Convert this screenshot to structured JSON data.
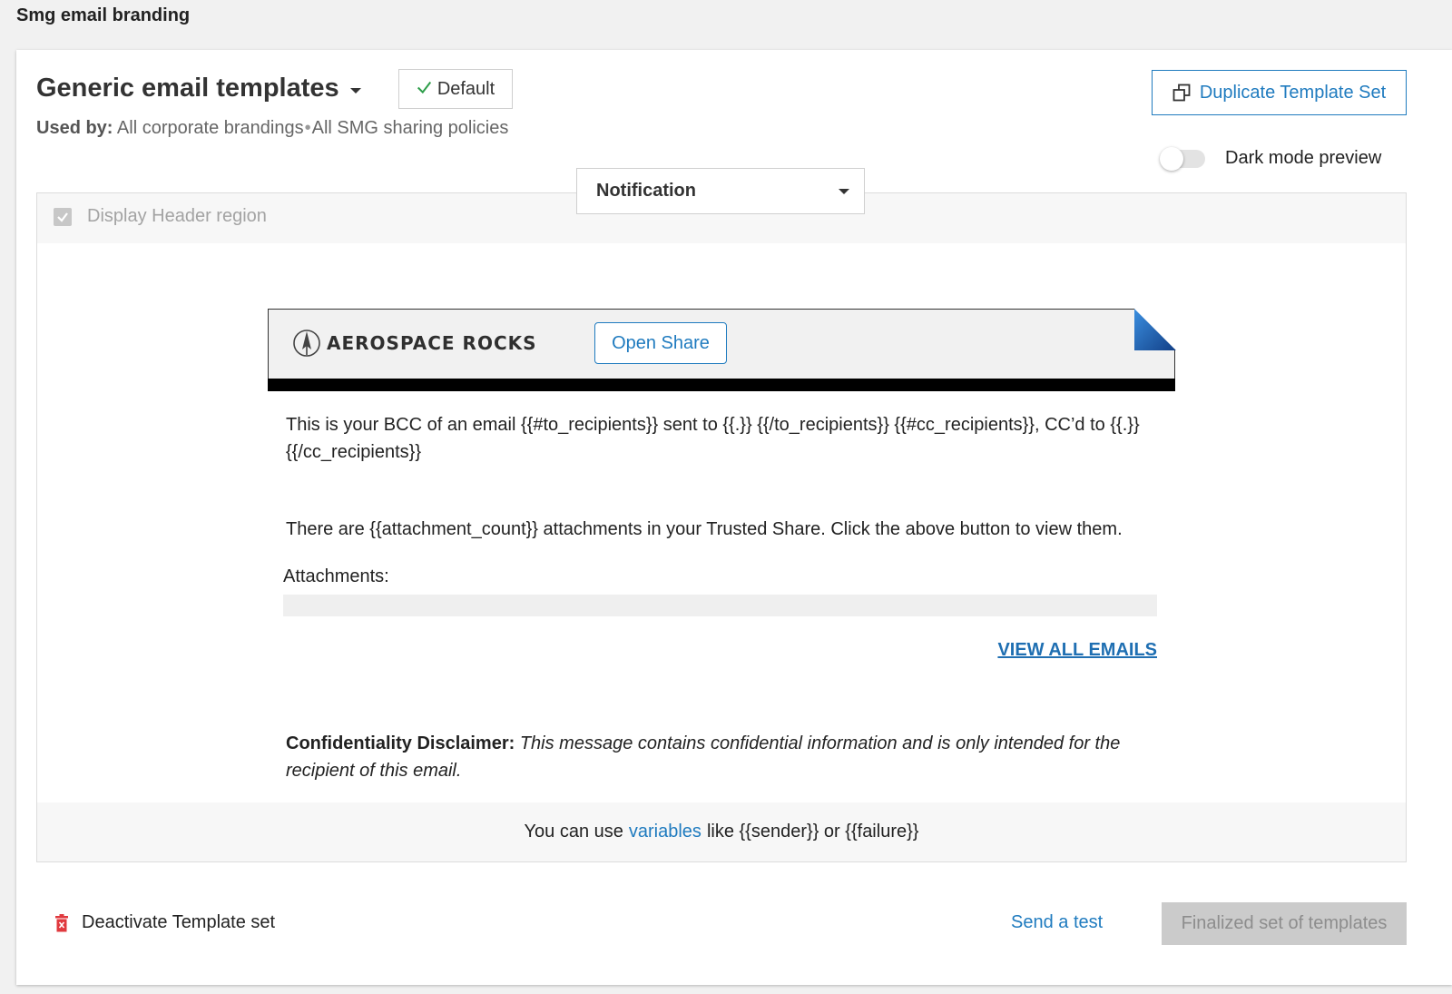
{
  "page": {
    "title": "Smg email branding"
  },
  "template_set": {
    "name": "Generic email templates",
    "default_label": "Default",
    "used_by_label": "Used by:",
    "used_by_items": [
      "All corporate brandings",
      "All SMG sharing policies"
    ],
    "used_by_separator": "•"
  },
  "actions": {
    "duplicate_label": "Duplicate Template Set",
    "dark_mode_label": "Dark mode preview",
    "dark_mode_on": false
  },
  "editor": {
    "header_region_label": "Display Header region",
    "header_region_checked": true,
    "template_select_value": "Notification",
    "preview": {
      "logo_text": "AEROSPACE ROCKS",
      "open_share_label": "Open Share",
      "bcc_text": "This is your BCC of an email {{#to_recipients}} sent to {{.}} {{/to_recipients}} {{#cc_recipients}}, CC’d to {{.}} {{/cc_recipients}}",
      "attachments_text": "There are {{attachment_count}} attachments in your Trusted Share. Click the above button to view them.",
      "attachments_label": "Attachments:",
      "view_all_label": "VIEW ALL EMAILS",
      "disclaimer_label": "Confidentiality Disclaimer:",
      "disclaimer_text": "This message contains confidential information and is only intended for the recipient of this email."
    },
    "footer": {
      "prefix": "You can use",
      "link": "variables",
      "suffix": "like {{sender}} or {{failure}}"
    }
  },
  "bottom_actions": {
    "deactivate_label": "Deactivate Template set",
    "send_test_label": "Send a test",
    "finalize_label": "Finalized set of templates"
  },
  "colors": {
    "accent": "#1f7bbf",
    "danger": "#e0393e",
    "check_green": "#2e9e4a",
    "corner_blue": "#1a5fb0"
  },
  "icons": {
    "default_badge": "check-icon",
    "duplicate": "duplicate-icon",
    "deactivate": "trash-icon",
    "logo": "rocket-logo-icon"
  }
}
